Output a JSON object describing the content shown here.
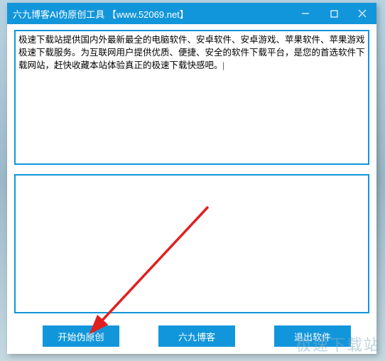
{
  "window": {
    "title": "六九博客AI伪原创工具 【www.52069.net】"
  },
  "input": {
    "text": "极速下载站提供国内外最新最全的电脑软件、安卓软件、安卓游戏、苹果软件、苹果游戏极速下载服务。为互联网用户提供优质、便捷、安全的软件下载平台，是您的首选软件下载网站，赶快收藏本站体验真正的极速下载快感吧。|"
  },
  "output": {
    "text": ""
  },
  "buttons": {
    "start": "开始伪原创",
    "blog": "六九博客",
    "exit": "退出软件"
  },
  "watermark": "极速下载站"
}
